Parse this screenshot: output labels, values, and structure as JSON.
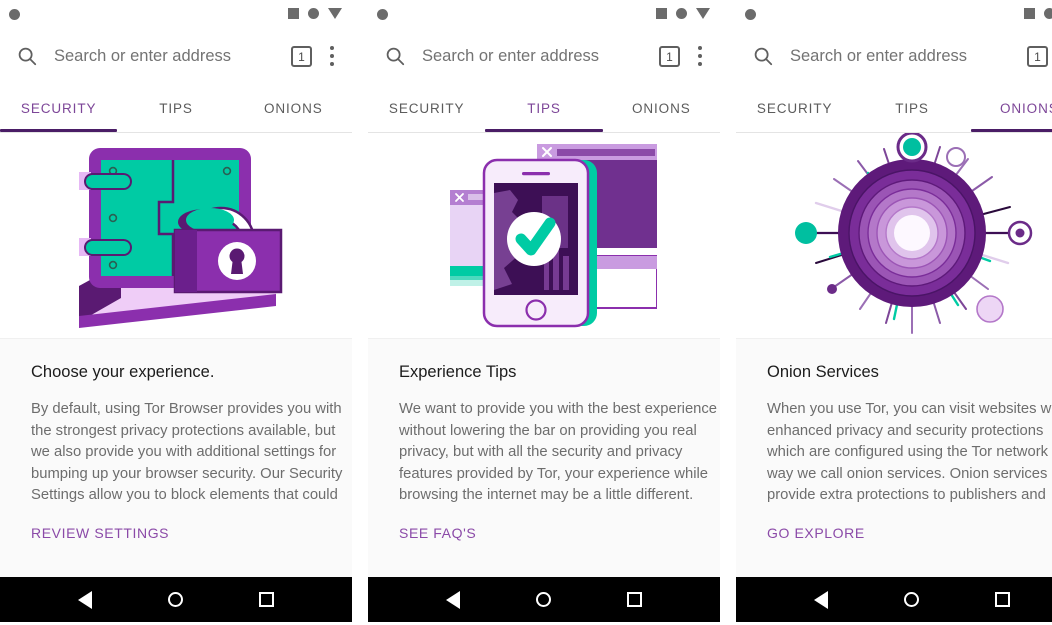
{
  "statusbar": {
    "left_icon": "circle-dot-icon",
    "right_icons": [
      "square-icon",
      "circle-icon",
      "triangle-down-icon"
    ]
  },
  "toolbar": {
    "search_placeholder": "Search or enter address",
    "search_icon": "search-icon",
    "tab_count": "1",
    "menu_icon": "kebab-menu-icon"
  },
  "tabs": [
    {
      "label": "SECURITY"
    },
    {
      "label": "TIPS"
    },
    {
      "label": "ONIONS"
    }
  ],
  "colors": {
    "accent_purple": "#7d4698",
    "underline_purple": "#4a1d66",
    "link_purple": "#8b4aa8",
    "teal": "#00c5a0",
    "card_bg": "#fafafa",
    "text_body": "#6d6d6d",
    "text_title": "#1c1c1c"
  },
  "navbar": {
    "back": "back-triangle-icon",
    "home": "home-circle-icon",
    "recents": "recents-square-icon"
  },
  "panels": [
    {
      "active_tab_index": 0,
      "illustration": "safe-with-padlock-illustration",
      "title": "Choose your experience.",
      "body": "By default, using Tor Browser provides you with\nthe strongest privacy protections available, but\nwe also provide you with additional settings for\nbumping up your browser security. Our Security\nSettings allow you to block elements that could",
      "link": "REVIEW SETTINGS"
    },
    {
      "active_tab_index": 1,
      "illustration": "phone-checkmark-illustration",
      "title": "Experience Tips",
      "body": "We want to provide you with the best experience\nwithout lowering the bar on providing you real\nprivacy, but with all the security and privacy\nfeatures provided by Tor, your experience while\nbrowsing the internet may be a little different.",
      "link": "SEE FAQ'S"
    },
    {
      "active_tab_index": 2,
      "illustration": "onion-rays-illustration",
      "title": "Onion Services",
      "body": "When you use Tor, you can visit websites with\nenhanced privacy and security protections\nwhich are configured using the Tor network in a\nway we call onion services. Onion services\nprovide extra protections to publishers and",
      "link": "GO EXPLORE"
    }
  ]
}
